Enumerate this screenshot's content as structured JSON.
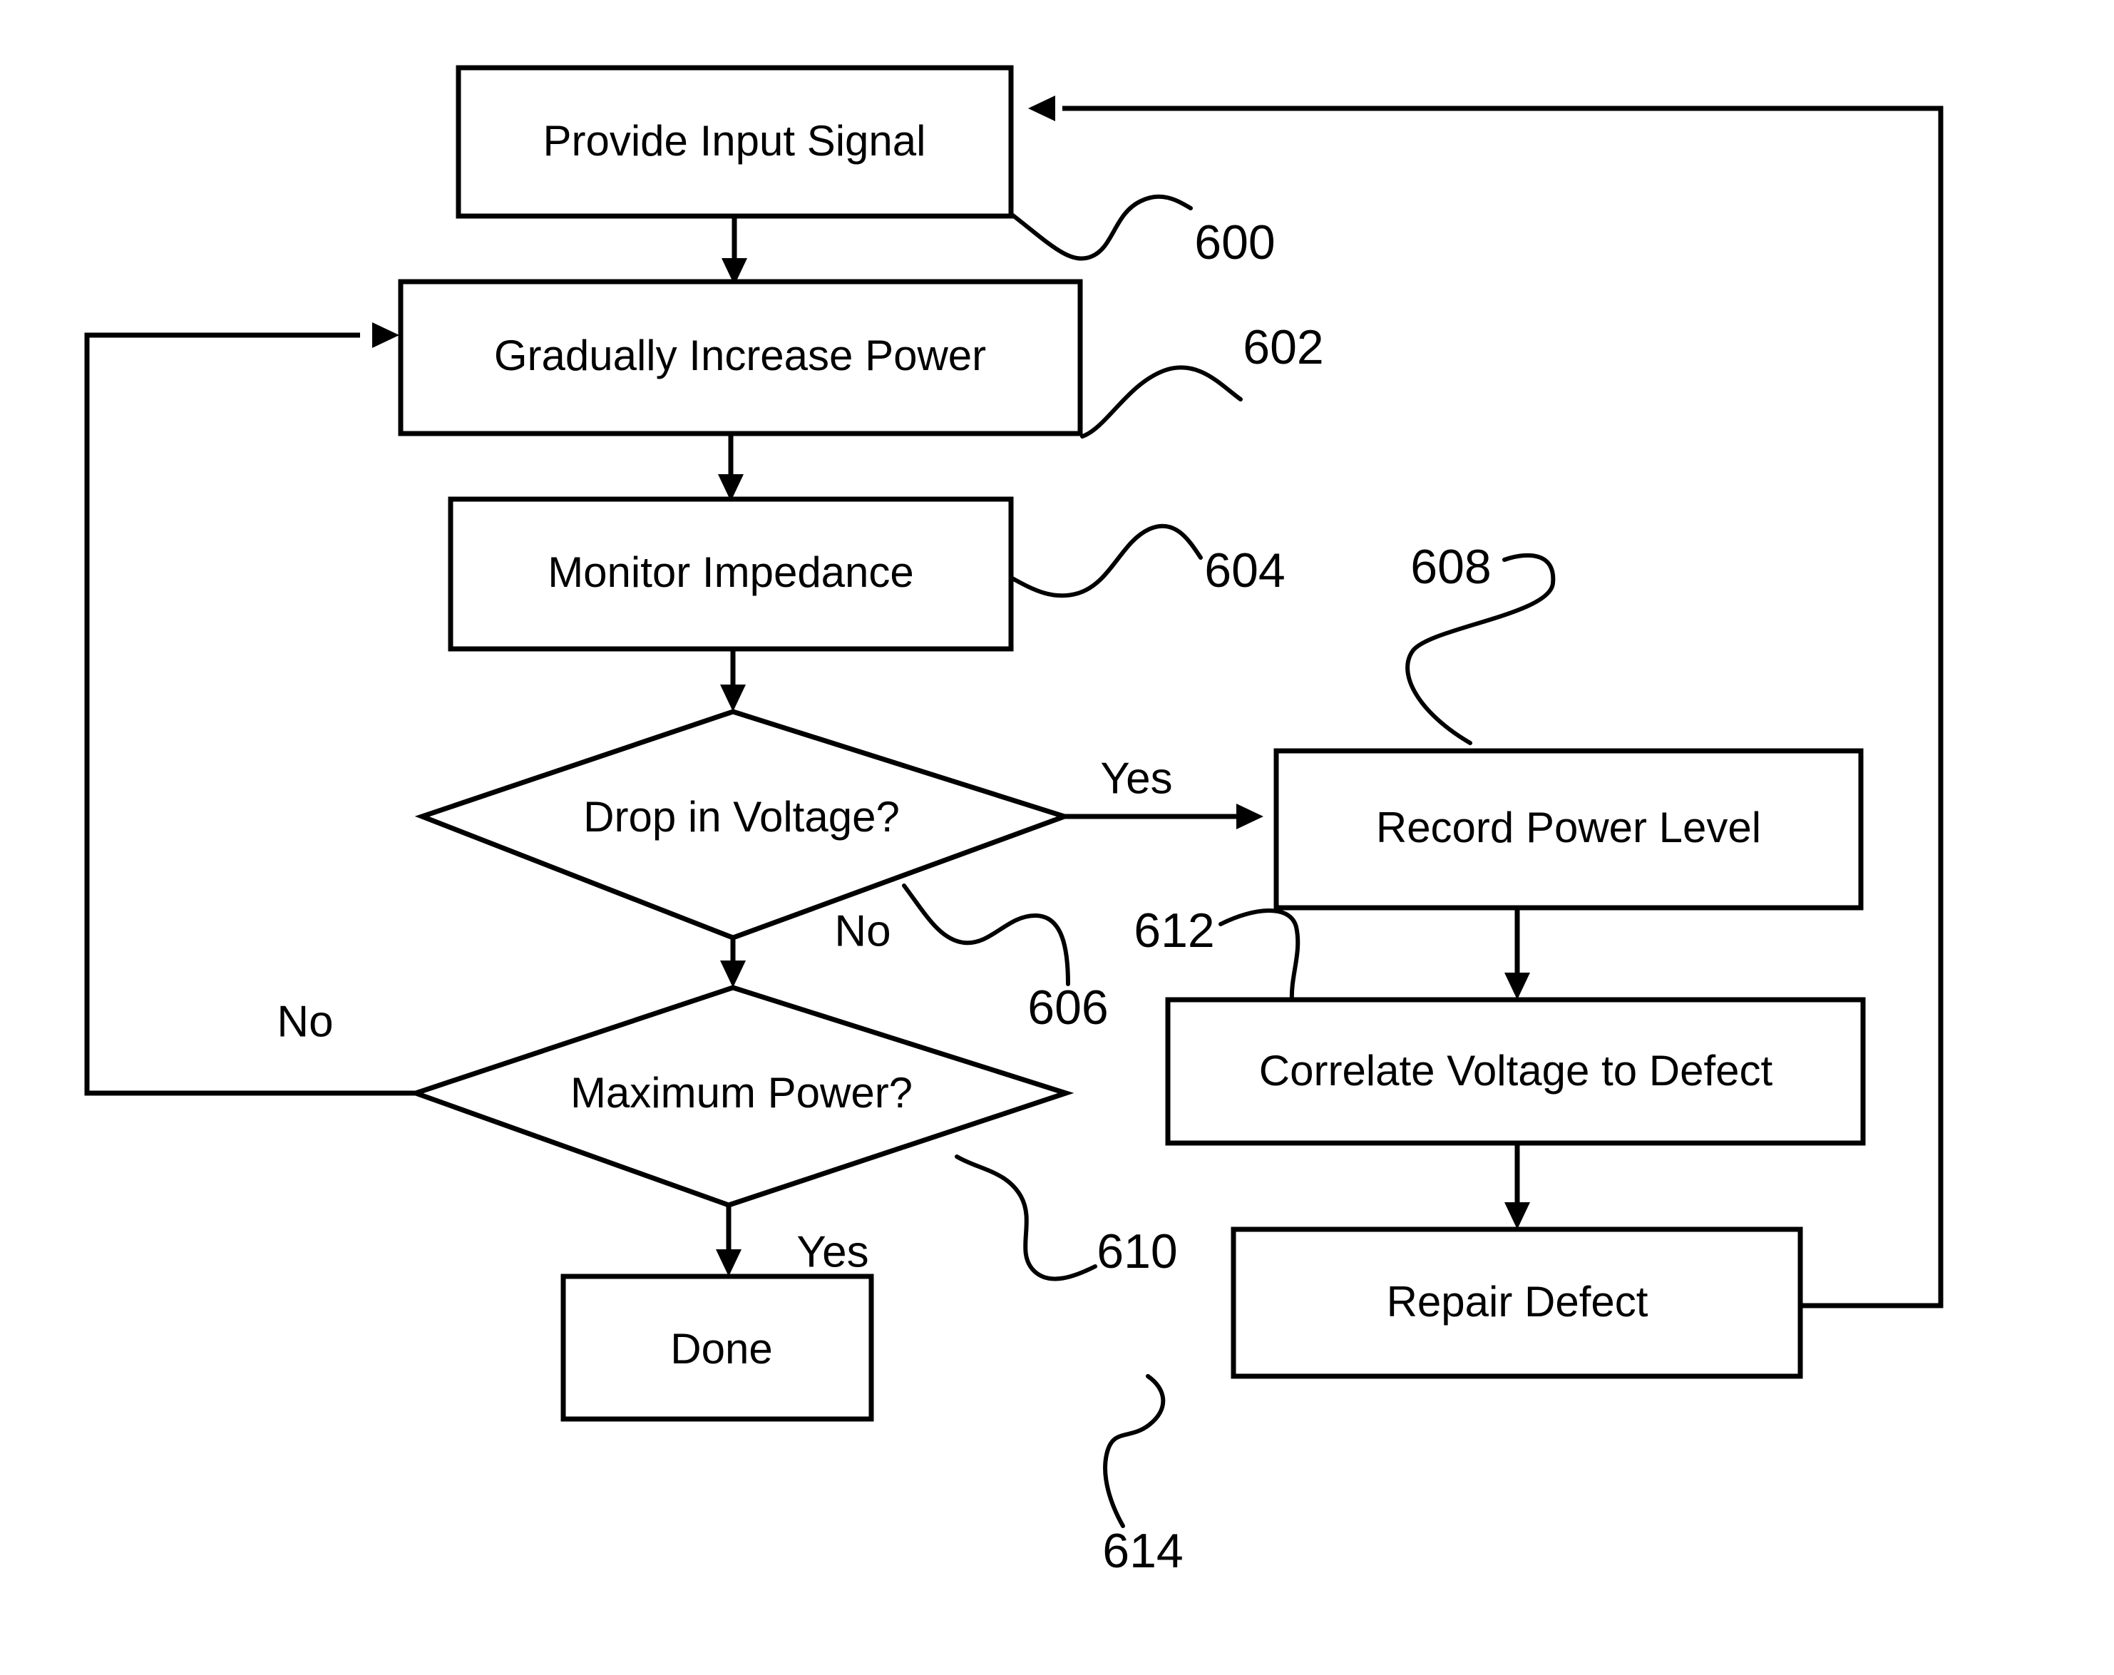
{
  "figure": {
    "title": "Defect detection and repair process flowchart",
    "background_color": "#ffffff",
    "line_color": "#000000"
  },
  "nodes": {
    "provide_input_signal": {
      "label": "Provide Input Signal",
      "shape": "rectangle"
    },
    "gradually_increase_power": {
      "label": "Gradually Increase Power",
      "shape": "rectangle"
    },
    "monitor_impedance": {
      "label": "Monitor Impedance",
      "shape": "rectangle"
    },
    "drop_in_voltage": {
      "label": "Drop in Voltage?",
      "shape": "diamond"
    },
    "maximum_power": {
      "label": "Maximum Power?",
      "shape": "diamond"
    },
    "done": {
      "label": "Done",
      "shape": "rectangle"
    },
    "record_power_level": {
      "label": "Record Power Level",
      "shape": "rectangle"
    },
    "correlate_voltage_to_defect": {
      "label": "Correlate Voltage to Defect",
      "shape": "rectangle"
    },
    "repair_defect": {
      "label": "Repair Defect",
      "shape": "rectangle"
    }
  },
  "branch_labels": {
    "drop_in_voltage_yes": "Yes",
    "drop_in_voltage_no": "No",
    "maximum_power_no": "No",
    "maximum_power_yes": "Yes"
  },
  "reference_numerals": {
    "provide_input_signal": "600",
    "gradually_increase_power": "602",
    "monitor_impedance": "604",
    "drop_in_voltage": "606",
    "record_power_level": "608",
    "maximum_power": "610",
    "correlate_voltage_to_defect": "612",
    "repair_defect": "614"
  }
}
